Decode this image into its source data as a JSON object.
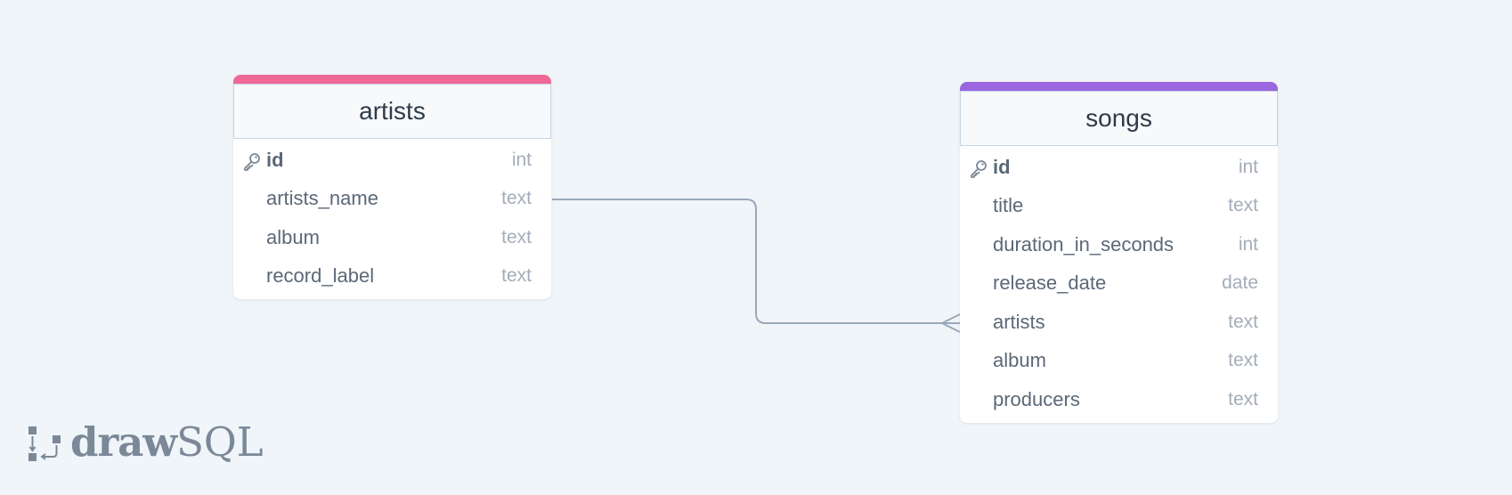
{
  "colors": {
    "background": "#eff5f8",
    "artists_accent": "#f06895",
    "songs_accent": "#9a67e0",
    "connector": "#9aa8ba"
  },
  "tables": {
    "artists": {
      "name": "artists",
      "columns": [
        {
          "name": "id",
          "type": "int",
          "pk": true
        },
        {
          "name": "artists_name",
          "type": "text"
        },
        {
          "name": "album",
          "type": "text"
        },
        {
          "name": "record_label",
          "type": "text"
        }
      ]
    },
    "songs": {
      "name": "songs",
      "columns": [
        {
          "name": "id",
          "type": "int",
          "pk": true
        },
        {
          "name": "title",
          "type": "text"
        },
        {
          "name": "duration_in_seconds",
          "type": "int"
        },
        {
          "name": "release_date",
          "type": "date"
        },
        {
          "name": "artists",
          "type": "text"
        },
        {
          "name": "album",
          "type": "text"
        },
        {
          "name": "producers",
          "type": "text"
        }
      ]
    }
  },
  "relationship": {
    "from": "artists.artists_name",
    "to": "songs.artists",
    "cardinality": "one-to-many"
  },
  "logo": {
    "bold": "draw",
    "light": "SQL"
  }
}
